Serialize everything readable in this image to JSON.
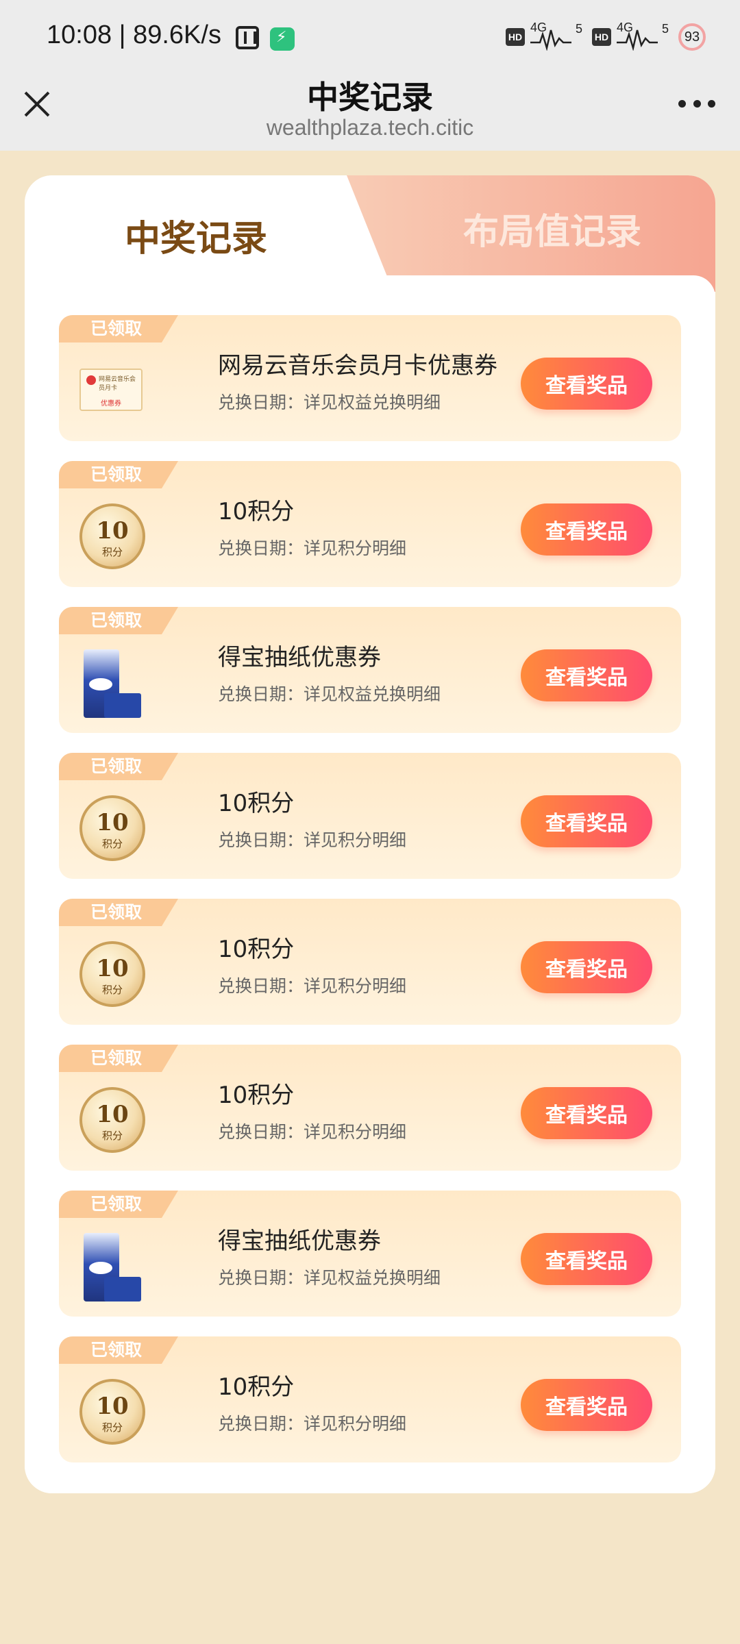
{
  "status_bar": {
    "time": "10:08 | 89.6K/s",
    "hd1": "HD",
    "net1": "4G",
    "bars1": "5",
    "hd2": "HD",
    "net2": "4G",
    "bars2": "5",
    "battery": "93"
  },
  "header": {
    "title": "中奖记录",
    "url": "wealthplaza.tech.citic"
  },
  "tabs": {
    "active": "中奖记录",
    "inactive": "布局值记录"
  },
  "items": [
    {
      "badge": "已领取",
      "title": "网易云音乐会员月卡优惠券",
      "subtitle": "兑换日期：详见权益兑换明细",
      "button": "查看奖品",
      "icon": "voucher-icon",
      "voucher_line": "网易云音乐会员月卡",
      "voucher_tag": "优惠券"
    },
    {
      "badge": "已领取",
      "title": "10积分",
      "subtitle": "兑换日期：详见积分明细",
      "button": "查看奖品",
      "icon": "points-coin-icon",
      "coin_num": "10",
      "coin_label": "积分"
    },
    {
      "badge": "已领取",
      "title": "得宝抽纸优惠券",
      "subtitle": "兑换日期：详见权益兑换明细",
      "button": "查看奖品",
      "icon": "tissue-icon"
    },
    {
      "badge": "已领取",
      "title": "10积分",
      "subtitle": "兑换日期：详见积分明细",
      "button": "查看奖品",
      "icon": "points-coin-icon",
      "coin_num": "10",
      "coin_label": "积分"
    },
    {
      "badge": "已领取",
      "title": "10积分",
      "subtitle": "兑换日期：详见积分明细",
      "button": "查看奖品",
      "icon": "points-coin-icon",
      "coin_num": "10",
      "coin_label": "积分"
    },
    {
      "badge": "已领取",
      "title": "10积分",
      "subtitle": "兑换日期：详见积分明细",
      "button": "查看奖品",
      "icon": "points-coin-icon",
      "coin_num": "10",
      "coin_label": "积分"
    },
    {
      "badge": "已领取",
      "title": "得宝抽纸优惠券",
      "subtitle": "兑换日期：详见权益兑换明细",
      "button": "查看奖品",
      "icon": "tissue-icon"
    },
    {
      "badge": "已领取",
      "title": "10积分",
      "subtitle": "兑换日期：详见积分明细",
      "button": "查看奖品",
      "icon": "points-coin-icon",
      "coin_num": "10",
      "coin_label": "积分"
    }
  ],
  "colors": {
    "page_bg": "#f4e5c8",
    "button_start": "#ff8b3b",
    "button_end": "#ff4c6e",
    "active_tab_text": "#7a4a14",
    "badge_bg": "#fbc996"
  }
}
